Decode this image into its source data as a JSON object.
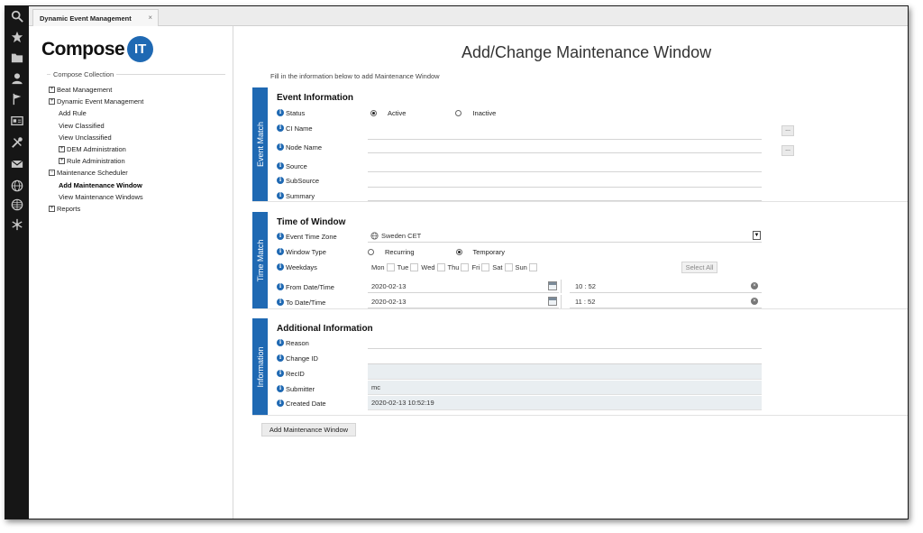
{
  "tab": {
    "title": "Dynamic Event Management",
    "close": "×"
  },
  "iconbar": [
    "search-icon",
    "star-icon",
    "folder-icon",
    "user-icon",
    "flag-icon",
    "id-card-icon",
    "tools-icon",
    "mail-icon",
    "globe-icon",
    "globe-grid-icon",
    "snowflake-icon"
  ],
  "logo": {
    "word": "Compose",
    "badge": "IT"
  },
  "sidebar": {
    "collection_title": "Compose Collection",
    "items": [
      {
        "label": "Beat Management",
        "expander": "+"
      },
      {
        "label": "Dynamic Event Management",
        "expander": "+"
      },
      {
        "label": "Add Rule"
      },
      {
        "label": "View Classified"
      },
      {
        "label": "View Unclassified"
      },
      {
        "label": "DEM Administration",
        "expander": "+"
      },
      {
        "label": "Rule Administration",
        "expander": "+"
      },
      {
        "label": "Maintenance Scheduler",
        "expander": "−"
      },
      {
        "label": "Add Maintenance Window"
      },
      {
        "label": "View Maintenance Windows"
      },
      {
        "label": "Reports",
        "expander": "+"
      }
    ]
  },
  "main": {
    "title": "Add/Change Maintenance Window",
    "intro": "Fill in the information below to add Maintenance Window",
    "info_glyph": "i",
    "event": {
      "side_label": "Event Match",
      "heading": "Event Information",
      "status_label": "Status",
      "status_active": "Active",
      "status_inactive": "Inactive",
      "ci_name_label": "CI Name",
      "node_name_label": "Node Name",
      "source_label": "Source",
      "subsource_label": "SubSource",
      "summary_label": "Summary",
      "dots": "..."
    },
    "time": {
      "side_label": "Time Match",
      "heading": "Time of Window",
      "timezone_label": "Event Time Zone",
      "timezone_value": "Sweden CET",
      "window_type_label": "Window Type",
      "type_recurring": "Recurring",
      "type_temporary": "Temporary",
      "weekdays_label": "Weekdays",
      "weekdays": [
        "Mon",
        "Tue",
        "Wed",
        "Thu",
        "Fri",
        "Sat",
        "Sun"
      ],
      "select_all": "Select All",
      "from_label": "From Date/Time",
      "from_date": "2020-02-13",
      "from_time": "10 : 52",
      "to_label": "To Date/Time",
      "to_date": "2020-02-13",
      "to_time": "11 : 52",
      "clear_glyph": "×"
    },
    "additional": {
      "side_label": "Information",
      "heading": "Additional Information",
      "reason_label": "Reason",
      "change_id_label": "Change ID",
      "recid_label": "RecID",
      "submitter_label": "Submitter",
      "submitter_value": "mc",
      "created_label": "Created Date",
      "created_value": "2020-02-13 10:52:19"
    },
    "submit_label": "Add Maintenance Window"
  }
}
